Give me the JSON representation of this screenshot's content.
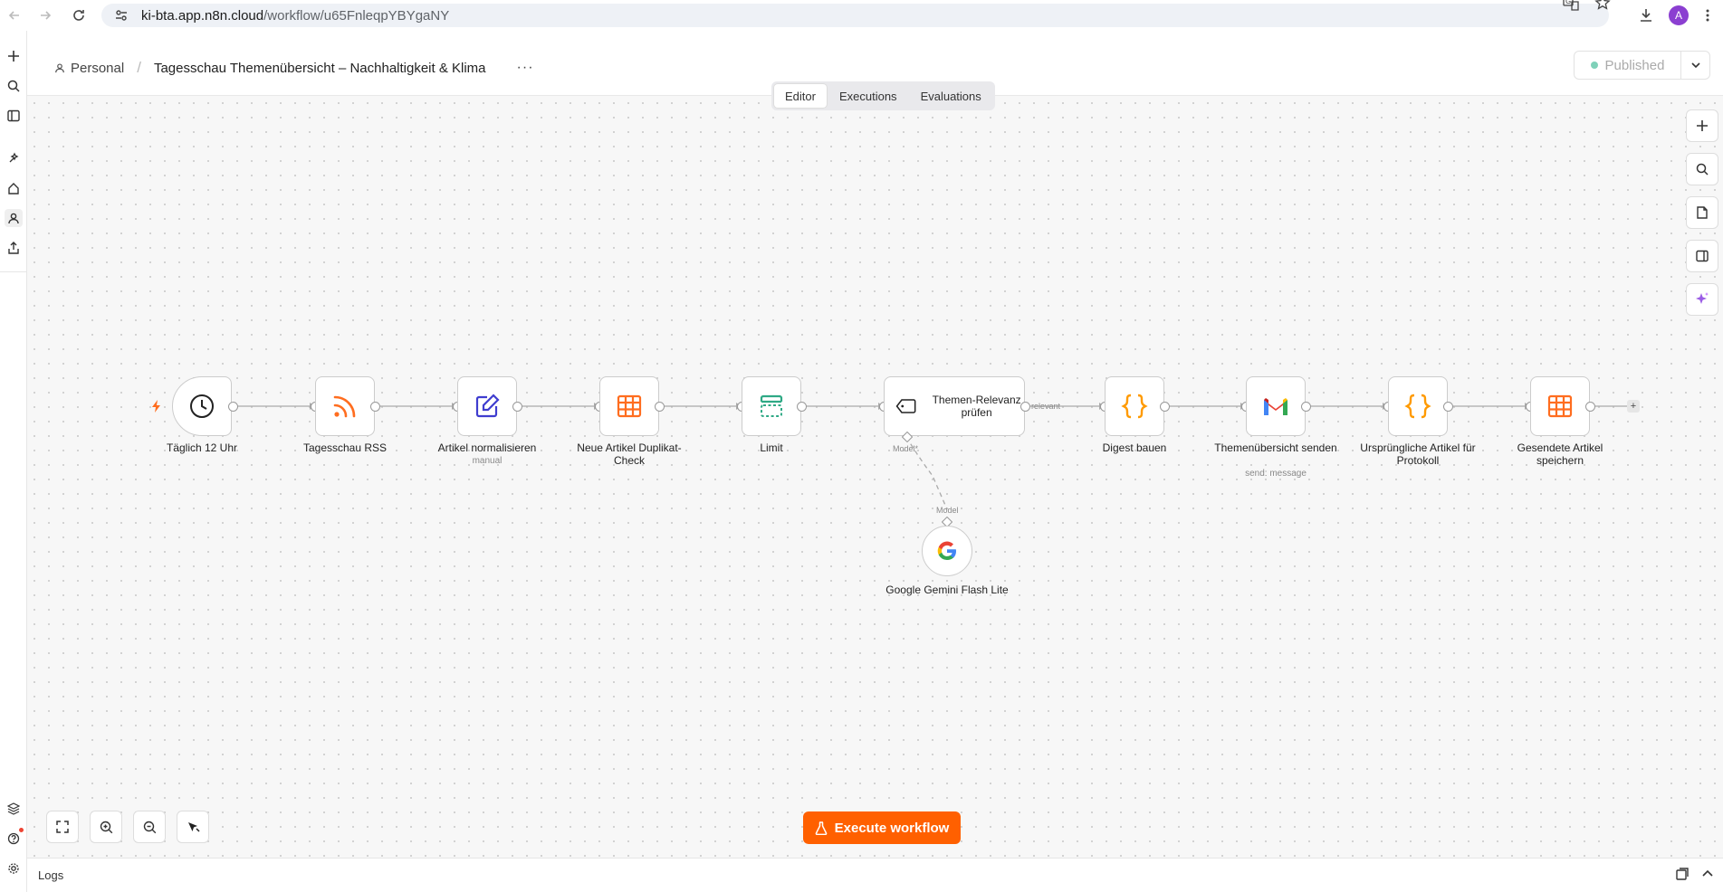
{
  "browser": {
    "url_host": "ki-bta.app.n8n.cloud",
    "url_path": "/workflow/u65FnleqpYBYgaNY",
    "avatar_letter": "A"
  },
  "header": {
    "breadcrumb_root": "Personal",
    "workflow_title": "Tagesschau Themenübersicht – Nachhaltigkeit & Klima",
    "more_label": "···",
    "publish_label": "Published"
  },
  "tabs": [
    {
      "label": "Editor",
      "active": true
    },
    {
      "label": "Executions",
      "active": false
    },
    {
      "label": "Evaluations",
      "active": false
    }
  ],
  "nodes": {
    "trigger": {
      "label": "Täglich 12 Uhr"
    },
    "rss": {
      "label": "Tagesschau RSS"
    },
    "normalize": {
      "label": "Artikel normalisieren",
      "sub": "manual"
    },
    "dupcheck": {
      "label": "Neue Artikel Duplikat-Check"
    },
    "limit": {
      "label": "Limit"
    },
    "relevance": {
      "label": "Themen-Relevanz prüfen",
      "output_label": "relevant",
      "model_label": "Model*"
    },
    "digest": {
      "label": "Digest bauen"
    },
    "send": {
      "label": "Themenübersicht senden",
      "sub": "send: message"
    },
    "original": {
      "label": "Ursprüngliche Artikel für Protokoll"
    },
    "save": {
      "label": "Gesendete Artikel speichern"
    },
    "gemini": {
      "label": "Google Gemini Flash Lite",
      "model_label": "Model"
    }
  },
  "execute_label": "Execute workflow",
  "logs_label": "Logs",
  "colors": {
    "accent": "#ff6000",
    "rss": "#ff6d1f",
    "normalize": "#3f3dcf",
    "table": "#ff6d1f",
    "limit": "#2fa985",
    "code": "#ff9a00",
    "published_dot": "#7fd1b9"
  }
}
